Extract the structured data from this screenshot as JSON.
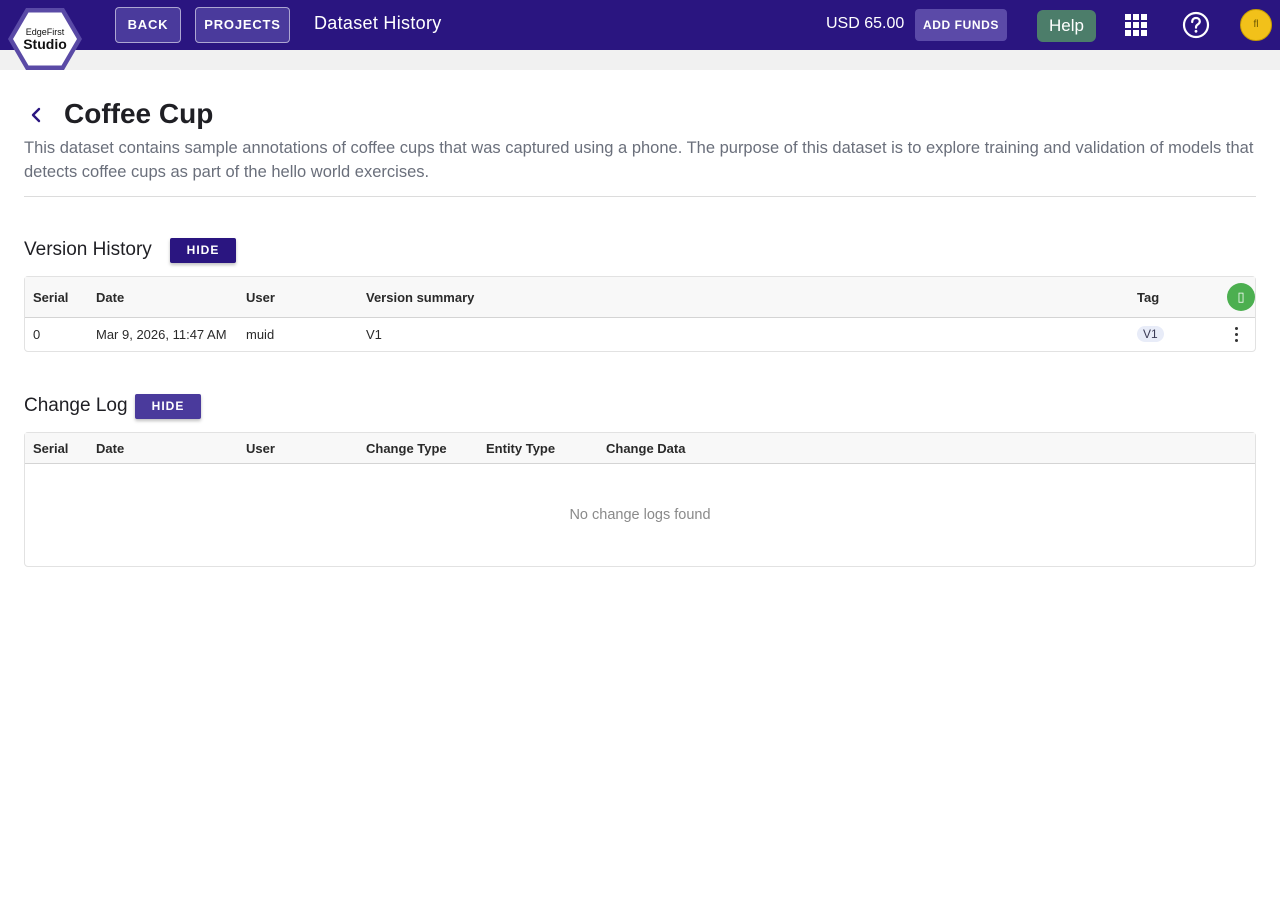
{
  "app": {
    "logo_small": "EdgeFirst",
    "logo_big": "Studio"
  },
  "nav": {
    "back_label": "BACK",
    "projects_label": "PROJECTS",
    "page_title": "Dataset History",
    "balance": "USD 65.00",
    "add_funds_label": "ADD FUNDS",
    "help_label": "Help",
    "apps_icon": "apps-grid-icon",
    "question_icon": "help-circle-icon",
    "avatar_initials": "fl",
    "colors": {
      "bar": "#2a1580",
      "help": "#4c7d6a",
      "avatar": "#f2c11a"
    }
  },
  "dataset": {
    "title": "Coffee Cup",
    "description": "This dataset contains sample annotations of coffee cups that was captured using a phone. The purpose of this dataset is to explore training and validation of models that detects coffee cups as part of the hello world exercises."
  },
  "version_history": {
    "title": "Version History",
    "hide_label": "HIDE",
    "columns": [
      "Serial",
      "Date",
      "User",
      "Version summary",
      "Tag"
    ],
    "rows": [
      {
        "serial": "0",
        "date": "Mar 9, 2026, 11:47 AM",
        "user": "muid",
        "summary": "V1",
        "tag": "V1"
      }
    ],
    "add_icon": "add-version-icon",
    "add_glyph": "▯"
  },
  "change_log": {
    "title": "Change Log",
    "hide_label": "HIDE",
    "columns": [
      "Serial",
      "Date",
      "User",
      "Change Type",
      "Entity Type",
      "Change Data"
    ],
    "empty_text": "No change logs found"
  }
}
